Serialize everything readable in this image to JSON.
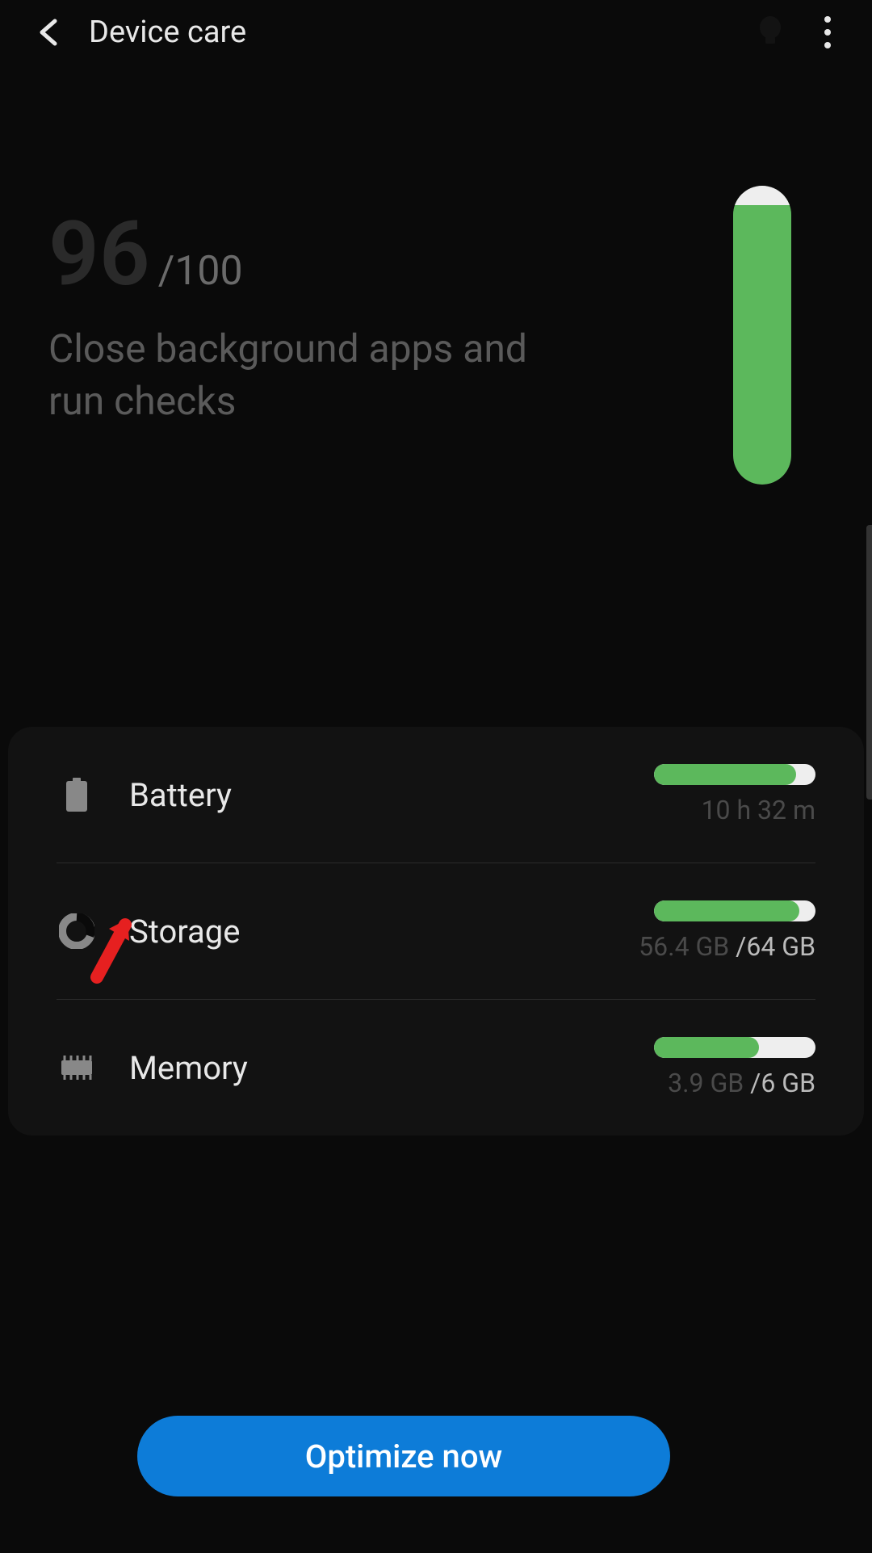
{
  "header": {
    "title": "Device care"
  },
  "score": {
    "value": "96",
    "max": "/100",
    "description": "Close background apps and run checks",
    "fill_percent": 96
  },
  "cards": {
    "battery": {
      "label": "Battery",
      "subtext": "10 h 32 m",
      "percent": 88
    },
    "storage": {
      "label": "Storage",
      "used": "56.4 GB ",
      "total": "/64 GB",
      "percent": 90
    },
    "memory": {
      "label": "Memory",
      "used": "3.9 GB ",
      "total": "/6 GB",
      "percent": 65
    }
  },
  "button": {
    "optimize": "Optimize now"
  }
}
